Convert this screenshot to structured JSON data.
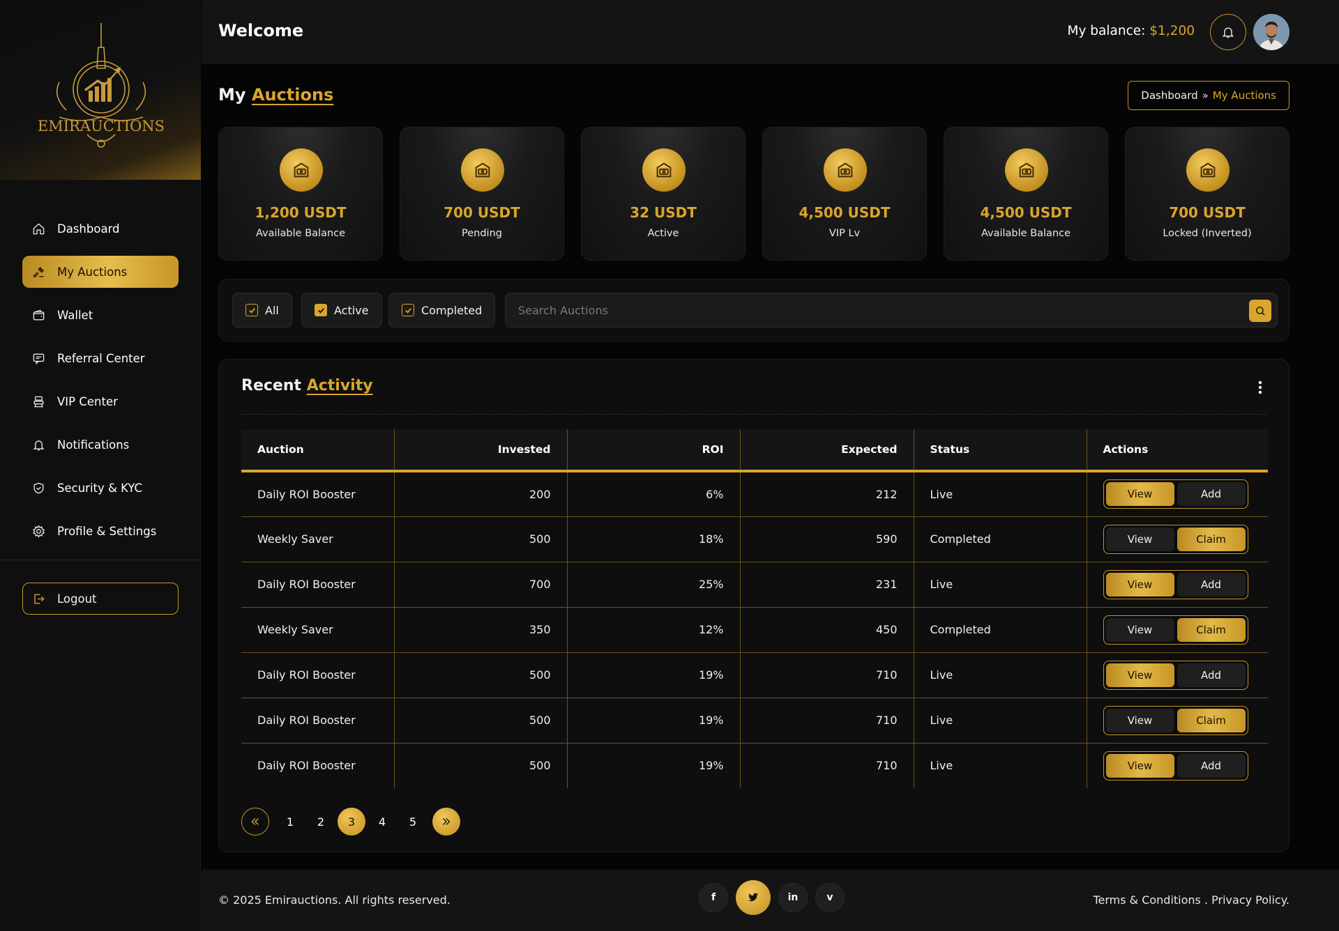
{
  "brand": {
    "name": "EMIRAUCTIONS"
  },
  "header": {
    "welcome": "Welcome",
    "balance_label": "My balance:",
    "balance_value": "$1,200"
  },
  "sidebar": {
    "items": [
      {
        "label": "Dashboard",
        "icon": "home-icon"
      },
      {
        "label": "My Auctions",
        "icon": "gavel-icon",
        "active": true
      },
      {
        "label": "Wallet",
        "icon": "wallet-icon"
      },
      {
        "label": "Referral Center",
        "icon": "referral-icon"
      },
      {
        "label": "VIP Center",
        "icon": "vip-icon"
      },
      {
        "label": "Notifications",
        "icon": "bell-icon"
      },
      {
        "label": "Security & KYC",
        "icon": "shield-icon"
      },
      {
        "label": "Profile & Settings",
        "icon": "gear-icon"
      }
    ],
    "logout": "Logout"
  },
  "page": {
    "title_plain": "My",
    "title_accent": "Auctions"
  },
  "breadcrumb": {
    "home": "Dashboard",
    "current": "My Auctions"
  },
  "cards": [
    {
      "value": "1,200 USDT",
      "label": "Available Balance"
    },
    {
      "value": "700 USDT",
      "label": "Pending"
    },
    {
      "value": "32 USDT",
      "label": "Active"
    },
    {
      "value": "4,500 USDT",
      "label": "VIP Lv"
    },
    {
      "value": "4,500 USDT",
      "label": "Available Balance"
    },
    {
      "value": "700 USDT",
      "label": "Locked (Inverted)"
    }
  ],
  "filters": {
    "all": "All",
    "active": "Active",
    "completed": "Completed",
    "search_placeholder": "Search Auctions"
  },
  "activity": {
    "title_plain": "Recent",
    "title_accent": "Activity",
    "columns": [
      "Auction",
      "Invested",
      "ROI",
      "Expected",
      "Status",
      "Actions"
    ],
    "rows": [
      {
        "auction": "Daily ROI Booster",
        "invested": "200",
        "roi": "6%",
        "expected": "212",
        "status": "Live",
        "a1": "View",
        "a2": "Add",
        "hl": 1
      },
      {
        "auction": "Weekly Saver",
        "invested": "500",
        "roi": "18%",
        "expected": "590",
        "status": "Completed",
        "a1": "View",
        "a2": "Claim",
        "hl": 2
      },
      {
        "auction": "Daily ROI Booster",
        "invested": "700",
        "roi": "25%",
        "expected": "231",
        "status": "Live",
        "a1": "View",
        "a2": "Add",
        "hl": 1
      },
      {
        "auction": "Weekly Saver",
        "invested": "350",
        "roi": "12%",
        "expected": "450",
        "status": "Completed",
        "a1": "View",
        "a2": "Claim",
        "hl": 2
      },
      {
        "auction": "Daily ROI Booster",
        "invested": "500",
        "roi": "19%",
        "expected": "710",
        "status": "Live",
        "a1": "View",
        "a2": "Add",
        "hl": 1
      },
      {
        "auction": "Daily ROI Booster",
        "invested": "500",
        "roi": "19%",
        "expected": "710",
        "status": "Live",
        "a1": "View",
        "a2": "Claim",
        "hl": 2
      },
      {
        "auction": "Daily ROI Booster",
        "invested": "500",
        "roi": "19%",
        "expected": "710",
        "status": "Live",
        "a1": "View",
        "a2": "Add",
        "hl": 1
      }
    ]
  },
  "pagination": {
    "pages": [
      "1",
      "2",
      "3",
      "4",
      "5"
    ],
    "current": "3"
  },
  "footer": {
    "copyright": "© 2025 Emirauctions. All rights reserved.",
    "terms": "Terms & Conditions . Privacy Policy."
  },
  "colors": {
    "accent": "#d9a52c",
    "background": "#050505",
    "panel": "#0e0e0e"
  }
}
